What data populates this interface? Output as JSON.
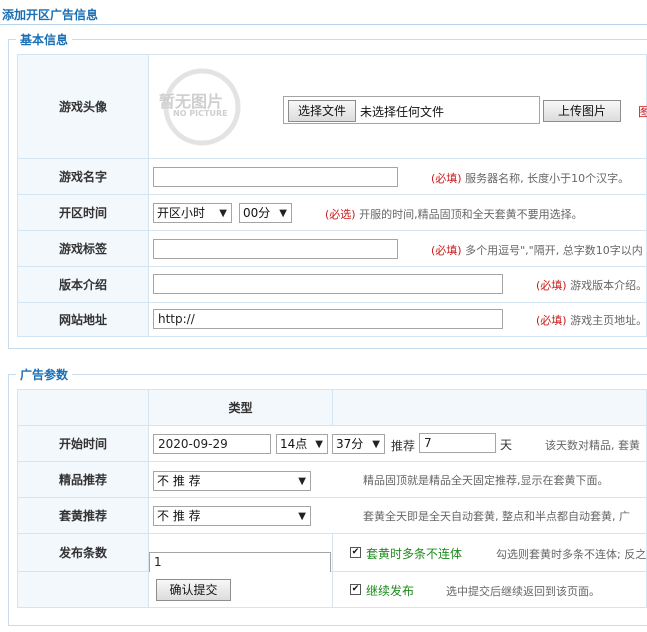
{
  "page_title": "添加开区广告信息",
  "basic": {
    "legend": "基本信息",
    "avatar": {
      "label": "游戏头像",
      "placeholder_text": "暂无图片",
      "placeholder_sub": "NO PICTURE",
      "file_button": "选择文件",
      "file_status": "未选择任何文件",
      "upload_button": "上传图片",
      "trailing": "图"
    },
    "name": {
      "label": "游戏名字",
      "value": "",
      "req": "(必填)",
      "hint": " 服务器名称, 长度小于10个汉字。"
    },
    "open_time": {
      "label": "开区时间",
      "hour_select": "开区小时",
      "minute_select": "00分",
      "req": "(必选)",
      "hint": " 开服的时间,精品固顶和全天套黄不要用选择。"
    },
    "tags": {
      "label": "游戏标签",
      "value": "",
      "req": "(必填)",
      "hint": " 多个用逗号\",\"隔开, 总字数10字以内"
    },
    "intro": {
      "label": "版本介绍",
      "value": "",
      "req": "(必填)",
      "hint": " 游戏版本介绍。"
    },
    "site": {
      "label": "网站地址",
      "value": "http://",
      "req": "(必填)",
      "hint": " 游戏主页地址。"
    }
  },
  "ad": {
    "legend": "广告参数",
    "header_type": "类型",
    "start": {
      "label": "开始时间",
      "date": "2020-09-29",
      "hour": "14点",
      "minute": "37分",
      "recommend_label": "推荐",
      "recommend_days": "7",
      "days_unit": "天",
      "hint": "该天数对精品, 套黄"
    },
    "featured": {
      "label": "精品推荐",
      "select": "不 推 荐",
      "hint": "精品固顶就是精品全天固定推荐,显示在套黄下面。"
    },
    "yellow": {
      "label": "套黄推荐",
      "select": "不 推 荐",
      "hint": "套黄全天即是全天自动套黄, 整点和半点都自动套黄, 广"
    },
    "count": {
      "label": "发布条数",
      "value": "1",
      "checkbox_label": "套黄时多条不连体",
      "hint": "勾选则套黄时多条不连体; 反之"
    },
    "submit": {
      "button": "确认提交",
      "checkbox_label": "继续发布",
      "hint": "选中提交后继续返回到该页面。"
    }
  },
  "colors": {
    "accent": "#1a6fb5",
    "required": "#c81b1b",
    "green": "#1d8a1d",
    "label_bg": "#f3f8fd"
  }
}
